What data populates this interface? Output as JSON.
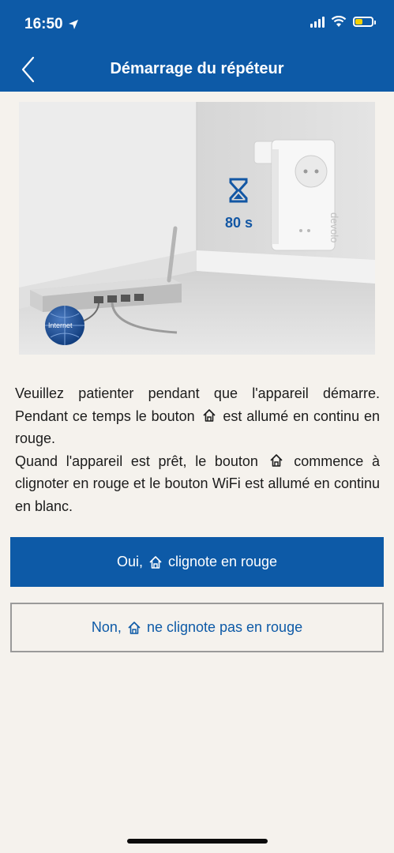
{
  "status_bar": {
    "time": "16:50",
    "icons": [
      "location-arrow-icon",
      "cellular-signal-icon",
      "wifi-icon",
      "battery-icon"
    ],
    "battery_color": "#f5d100"
  },
  "header": {
    "title": "Démarrage du répéteur",
    "back_icon": "chevron-left-icon",
    "background": "#0d5aa7"
  },
  "illustration": {
    "timer_label": "80 s",
    "globe_label": "Internet",
    "brand_label": "devolo"
  },
  "description": {
    "line1_before": "Veuillez patienter pendant que l'appareil démarre. Pendant ce temps le bouton",
    "line1_after": "est allumé en continu en rouge.",
    "line2_before": "Quand l'appareil est prêt, le bouton",
    "line2_after": "commence à clignoter en rouge et le bouton WiFi est allumé en continu en blanc.",
    "icon": "home-button-icon"
  },
  "buttons": {
    "yes_before": "Oui,",
    "yes_after": "clignote en rouge",
    "no_before": "Non,",
    "no_after": "ne clignote pas en rouge"
  },
  "colors": {
    "accent": "#0d5aa7",
    "page_background": "#f5f2ed"
  }
}
